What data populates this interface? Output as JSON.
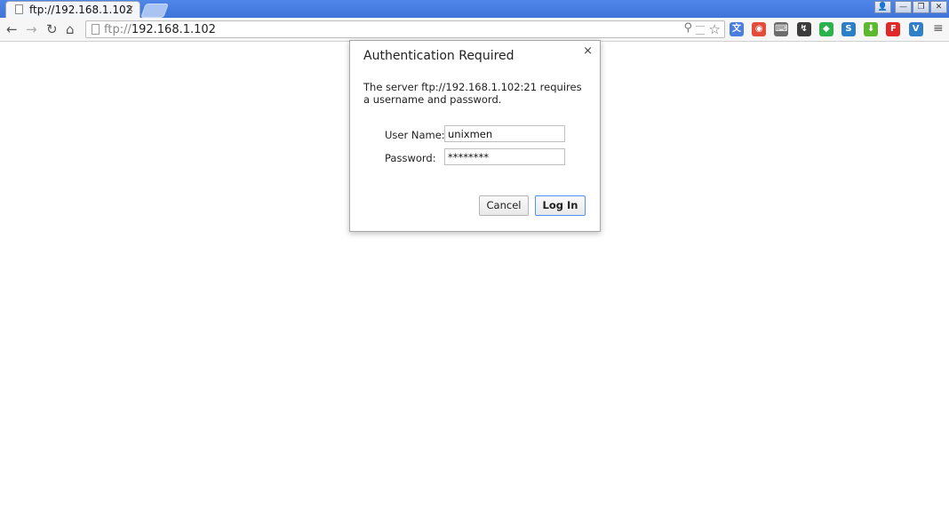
{
  "tab": {
    "title": "ftp://192.168.1.102",
    "close_glyph": "×"
  },
  "window_controls": {
    "profile_glyph": "👤",
    "minimize_glyph": "—",
    "restore_glyph": "❐",
    "close_glyph": "✕"
  },
  "toolbar": {
    "back_glyph": "←",
    "forward_glyph": "→",
    "reload_glyph": "↻",
    "home_glyph": "⌂",
    "menu_glyph": "≡"
  },
  "omnibox": {
    "scheme": "ftp://",
    "host": "192.168.1.102",
    "zoom_glyph": "⚲",
    "star_glyph": "☆"
  },
  "extensions": [
    {
      "icon": "translate-icon",
      "glyph": "文",
      "color": "#4a7fe0"
    },
    {
      "icon": "chrome-app-icon",
      "glyph": "◉",
      "color": "#e34b3a"
    },
    {
      "icon": "keyboard-icon",
      "glyph": "⌨",
      "color": "#6c6c6c"
    },
    {
      "icon": "wrench-icon",
      "glyph": "↯",
      "color": "#3b3b3b"
    },
    {
      "icon": "feedly-icon",
      "glyph": "◆",
      "color": "#2bb24c"
    },
    {
      "icon": "s-icon",
      "glyph": "S",
      "color": "#2a7fc7"
    },
    {
      "icon": "download-icon",
      "glyph": "⬇",
      "color": "#5cb82e"
    },
    {
      "icon": "flipboard-icon",
      "glyph": "F",
      "color": "#e12828"
    },
    {
      "icon": "v-icon",
      "glyph": "V",
      "color": "#2f80c8"
    }
  ],
  "dialog": {
    "title": "Authentication Required",
    "close_glyph": "×",
    "message": "The server ftp://192.168.1.102:21 requires a username and password.",
    "username_label": "User Name:",
    "username_value": "unixmen",
    "password_label": "Password:",
    "password_value": "********",
    "cancel_label": "Cancel",
    "login_label": "Log In"
  }
}
